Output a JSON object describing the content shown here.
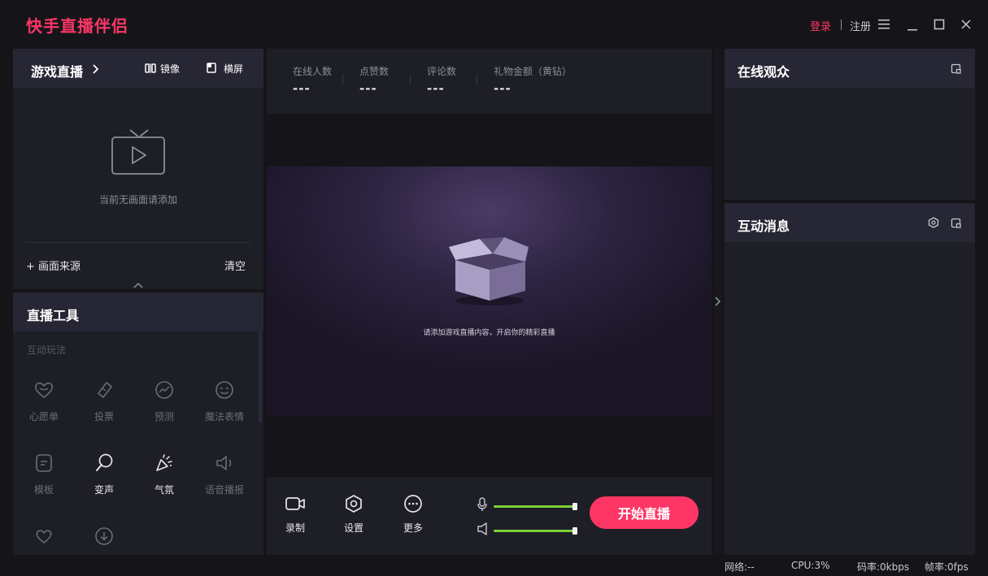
{
  "titlebar": {
    "app_title": "快手直播伴侣",
    "login": "登录",
    "register": "注册"
  },
  "game_live": {
    "title": "游戏直播",
    "mirror": "镜像",
    "landscape": "横屏",
    "empty_text": "当前无画面请添加",
    "add_source": "+ 画面来源",
    "clear": "清空"
  },
  "live_tools": {
    "title": "直播工具",
    "subtitle": "互动玩法",
    "tools": [
      {
        "label": "心愿单",
        "icon": "wishlist-heart-icon"
      },
      {
        "label": "投票",
        "icon": "vote-ticket-icon"
      },
      {
        "label": "预测",
        "icon": "prediction-chart-icon"
      },
      {
        "label": "魔法表情",
        "icon": "magic-face-icon"
      },
      {
        "label": "模板",
        "icon": "template-icon"
      },
      {
        "label": "变声",
        "icon": "voice-change-icon"
      },
      {
        "label": "气氛",
        "icon": "party-popper-icon"
      },
      {
        "label": "语音播报",
        "icon": "speaker-icon"
      }
    ]
  },
  "stats": [
    {
      "label": "在线人数",
      "value": "---"
    },
    {
      "label": "点赞数",
      "value": "---"
    },
    {
      "label": "评论数",
      "value": "---"
    },
    {
      "label": "礼物金额（黄钻）",
      "value": "---"
    }
  ],
  "preview": {
    "hint": "请添加游戏直播内容，开启你的精彩直播"
  },
  "controls": {
    "record": "录制",
    "settings": "设置",
    "more": "更多",
    "mic_level": 1.0,
    "speaker_level": 1.0,
    "start_button": "开始直播"
  },
  "right": {
    "online_viewers": "在线观众",
    "interactions": "互动消息"
  },
  "status": {
    "network": "网络:--",
    "cpu": "CPU:3%",
    "bitrate": "码率:0kbps",
    "fps": "帧率:0fps"
  },
  "colors": {
    "brand": "#fe3666",
    "slider": "#7cd23a",
    "panel": "#1e1e26",
    "panel_header": "#262634",
    "background": "#151519"
  }
}
